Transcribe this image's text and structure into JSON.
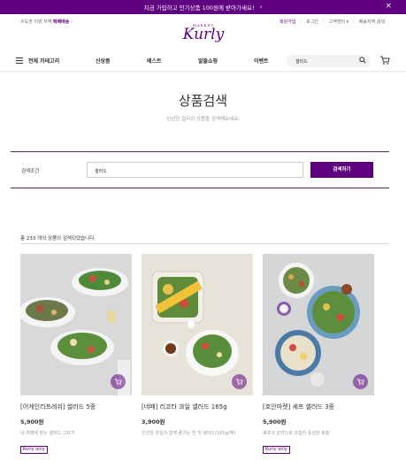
{
  "banner": {
    "text": "지금 가입하고 인기상품 100원에 받아가세요!",
    "arrow": "›",
    "close": "×"
  },
  "delivery": {
    "prefix": "수도권 이외 지역",
    "highlight": "택배배송",
    "arrow": "›"
  },
  "usermenu": {
    "signup": "회원가입",
    "sep1": "|",
    "login": "로그인",
    "sep2": "|",
    "cs": "고객센터 ▾",
    "sep3": "|",
    "area": "배송지역 검색"
  },
  "logo": {
    "market": "MARKET",
    "kurly": "Kurly"
  },
  "nav": {
    "all_categories": "전체 카테고리",
    "items": [
      "신상품",
      "베스트",
      "알뜰쇼핑",
      "이벤트"
    ]
  },
  "search": {
    "value": "샐러드"
  },
  "page": {
    "title": "상품검색",
    "subtitle": "신선한 컬리의 상품을 검색해보세요."
  },
  "search_form": {
    "label": "검색조건",
    "value": "샐러드",
    "button": "검색하기"
  },
  "results": {
    "count_text": "총 233 개의 상품이 검색되었습니다."
  },
  "products": [
    {
      "name": "[어게인리프레쉬] 샐러드 5종",
      "price": "5,900원",
      "desc": "내 취향에 맞는 샐러드 고르기",
      "badge": "Kurly only"
    },
    {
      "name": "[네떼] 리코타 과일 샐러드 165g",
      "price": "3,900원",
      "desc": "신선한 과일과 함께 즐기는 한 끼 샐러드(165g/팩)",
      "badge": ""
    },
    {
      "name": "[호안마켓] 셰프 샐러드 3종",
      "price": "5,900원",
      "desc": "셰프의 감각으로 조합한 풍성한 토핑",
      "badge": "Kurly only"
    }
  ],
  "colors": {
    "brand": "#5f0080",
    "border": "#522772"
  },
  "icons": [
    "menu-icon",
    "search-icon",
    "cart-icon",
    "close-icon",
    "add-to-cart-icon"
  ]
}
